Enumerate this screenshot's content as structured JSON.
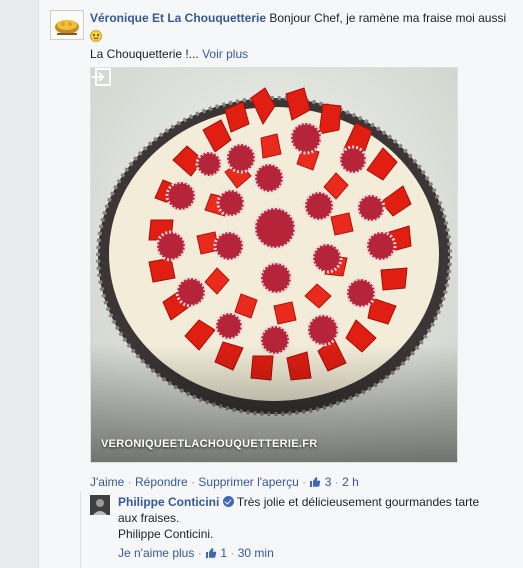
{
  "comment": {
    "author": "Véronique Et La Chouquetterie",
    "text": "Bonjour Chef, je ramène ma fraise moi aussi",
    "emoji": "smile-emoji",
    "text_line2": "La Chouquetterie !...",
    "see_more": "Voir plus"
  },
  "preview": {
    "domain": "VERONIQUEETLACHOUQUETTERIE.FR"
  },
  "actions": {
    "like": "J'aime",
    "sep1": "·",
    "reply": "Répondre",
    "sep2": "·",
    "remove_preview": "Supprimer l'aperçu",
    "sep3": "·",
    "like_count": "3",
    "sep4": "·",
    "time": "2 h"
  },
  "reply": {
    "author": "Philippe Conticini",
    "text": "Très jolie et délicieusement gourmandes tarte aux fraises.",
    "signature": "Philippe Conticini.",
    "unlike": "Je n'aime plus",
    "sep1": "·",
    "like_count": "1",
    "sep2": "·",
    "time": "30 min"
  },
  "colors": {
    "link": "#365899",
    "meta": "#90949c",
    "verified": "#4267b2"
  }
}
